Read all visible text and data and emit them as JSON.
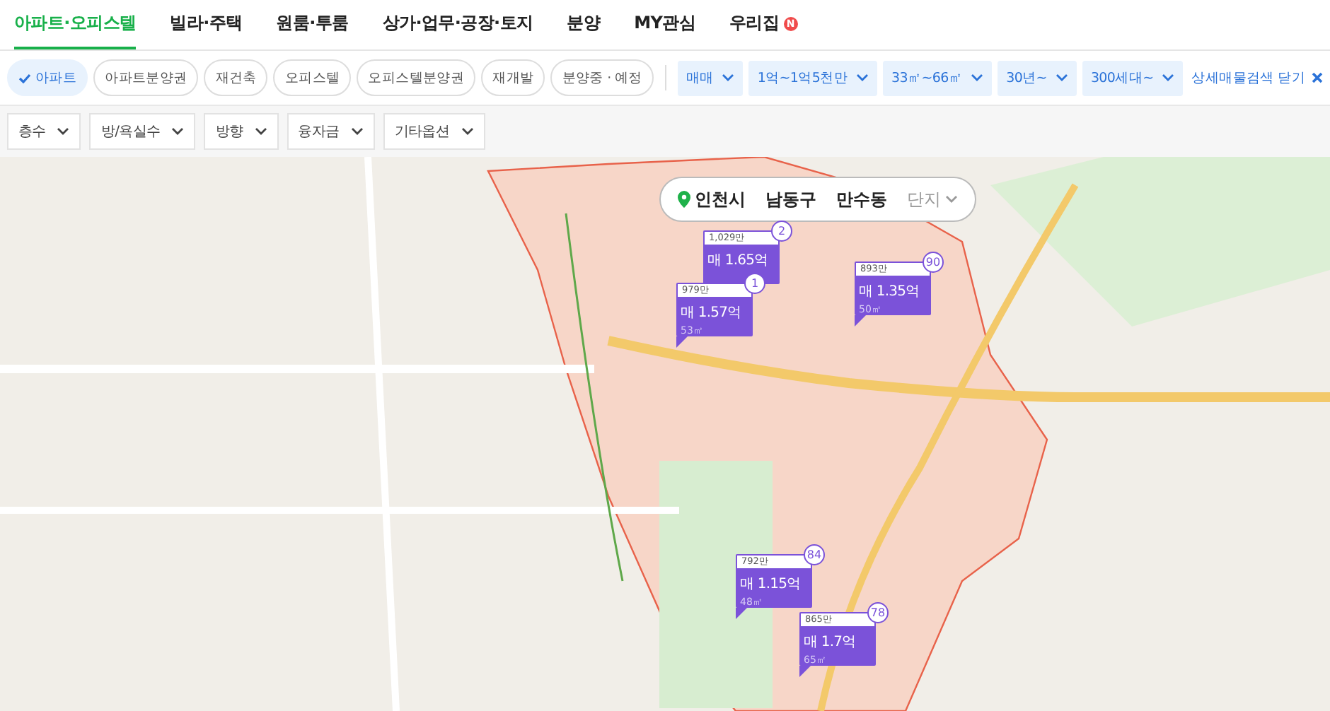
{
  "tabs": [
    {
      "label": "아파트·오피스텔",
      "selected": true
    },
    {
      "label": "빌라·주택",
      "selected": false
    },
    {
      "label": "원룸·투룸",
      "selected": false
    },
    {
      "label": "상가·업무·공장·토지",
      "selected": false
    },
    {
      "label": "분양",
      "selected": false
    },
    {
      "label": "MY관심",
      "selected": false
    },
    {
      "label": "우리집",
      "selected": false,
      "badge": "N"
    }
  ],
  "property_types": [
    {
      "label": "아파트",
      "selected": true
    },
    {
      "label": "아파트분양권",
      "selected": false
    },
    {
      "label": "재건축",
      "selected": false
    },
    {
      "label": "오피스텔",
      "selected": false
    },
    {
      "label": "오피스텔분양권",
      "selected": false
    },
    {
      "label": "재개발",
      "selected": false
    },
    {
      "label": "분양중 · 예정",
      "selected": false
    }
  ],
  "trade_filters": [
    "매매",
    "1억~1억5천만",
    "33㎡~66㎡",
    "30년~",
    "300세대~"
  ],
  "close_detail_search": "상세매물검색 닫기",
  "option_filters": [
    "층수",
    "방/욕실수",
    "방향",
    "융자금",
    "기타옵션"
  ],
  "breadcrumb": [
    {
      "label": "인천시",
      "active": true
    },
    {
      "label": "남동구",
      "active": true
    },
    {
      "label": "만수동",
      "active": true
    },
    {
      "label": "단지",
      "active": false
    }
  ],
  "markers": [
    {
      "unit_price": "1,029만",
      "price": "매 1.65억",
      "count": "2"
    },
    {
      "unit_price": "979만",
      "price": "매 1.57억",
      "area": "53㎡",
      "count": "1"
    },
    {
      "unit_price": "893만",
      "price": "매 1.35억",
      "area": "50㎡",
      "count": "90"
    },
    {
      "unit_price": "792만",
      "price": "매 1.15억",
      "area": "48㎡",
      "count": "84"
    },
    {
      "unit_price": "865만",
      "price": "매 1.7억",
      "area": "65㎡",
      "count": "78"
    }
  ]
}
